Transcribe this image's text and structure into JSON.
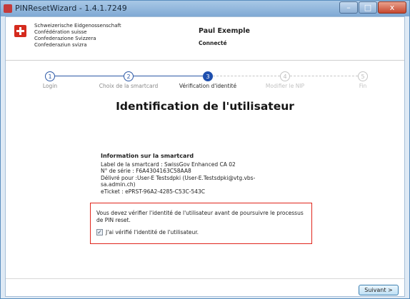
{
  "window": {
    "title": "PINResetWizard - 1.4.1.7249",
    "controls": {
      "minimize": "–",
      "maximize": "□",
      "close": "x"
    }
  },
  "header": {
    "admin_lines": [
      "Schweizerische Eidgenossenschaft",
      "Confédération suisse",
      "Confederazione Svizzera",
      "Confederaziun svizra"
    ],
    "user_name": "Paul Exemple",
    "user_status": "Connecté"
  },
  "steps": [
    {
      "number": "1",
      "label": "Login",
      "state": "done"
    },
    {
      "number": "2",
      "label": "Choix de la smartcard",
      "state": "done"
    },
    {
      "number": "3",
      "label": "Vérification d'identité",
      "state": "active"
    },
    {
      "number": "4",
      "label": "Modifier le NIP",
      "state": "future"
    },
    {
      "number": "5",
      "label": "Fin",
      "state": "future"
    }
  ],
  "page_title": "Identification de l'utilisateur",
  "info": {
    "heading": "Information sur la smartcard",
    "lines": [
      "Label de la smartcard : SwissGov Enhanced CA 02",
      "N° de série : F6A4304163C58AA8",
      "Délivré pour :User-E Testsdpki (User-E.Testsdpki@vtg.vbs-",
      "sa.admin.ch)",
      "eTicket : ePRST-96A2-4285-C53C-543C"
    ]
  },
  "verification": {
    "text": "Vous devez vérifier l'identité de l'utilisateur avant de poursuivre le processus de PIN reset.",
    "checkbox_label": "J'ai vérifié l'identité de l'utilisateur.",
    "checked_glyph": "✓"
  },
  "footer": {
    "next_label": "Suivant >"
  }
}
